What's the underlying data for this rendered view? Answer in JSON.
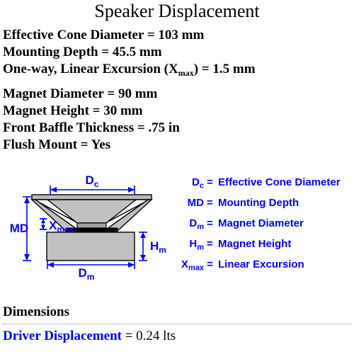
{
  "title": "Speaker Displacement",
  "specs": [
    {
      "label": "Effective Cone Diameter = 103 mm",
      "gap": false
    },
    {
      "label": "Mounting Depth = 45.5 mm",
      "gap": false
    },
    {
      "label": "One-way, Linear Excursion (X",
      "sub": "max",
      "tail": ") = 1.5 mm",
      "gap": false
    },
    {
      "label": "Magnet Diameter = 90 mm",
      "gap": true
    },
    {
      "label": "Magnet Height = 30 mm",
      "gap": false
    },
    {
      "label": "Front Baffle Thickness = .75 in",
      "gap": false
    },
    {
      "label": "Flush Mount = Yes",
      "gap": false
    }
  ],
  "diagram": {
    "callouts": {
      "dc": "D",
      "dc_sub": "c",
      "md": "MD",
      "xmax": "X",
      "xmax_sub": "max",
      "hm": "H",
      "hm_sub": "m",
      "dm": "D",
      "dm_sub": "m"
    },
    "colors": {
      "annotation": "#0000ff",
      "body_fill": "#c0c0c0",
      "shadow_fill": "#a8a8a8",
      "outline": "#000000",
      "gap_fill": "#000000"
    }
  },
  "legend": [
    {
      "sym": "D",
      "sub": "c",
      "eq": "=",
      "text": "Effective Cone Diameter"
    },
    {
      "sym": "MD",
      "sub": "",
      "eq": "=",
      "text": "Mounting Depth"
    },
    {
      "sym": "D",
      "sub": "m",
      "eq": "=",
      "text": "Magnet Diameter"
    },
    {
      "sym": "H",
      "sub": "m",
      "eq": "=",
      "text": "Magnet Height"
    },
    {
      "sym": "X",
      "sub": "max",
      "eq": "=",
      "text": "Linear Excursion"
    }
  ],
  "bottom": {
    "section_heading": "Dimensions",
    "result_label": "Driver Displacement",
    "result_value": " = 0.24 lts"
  }
}
